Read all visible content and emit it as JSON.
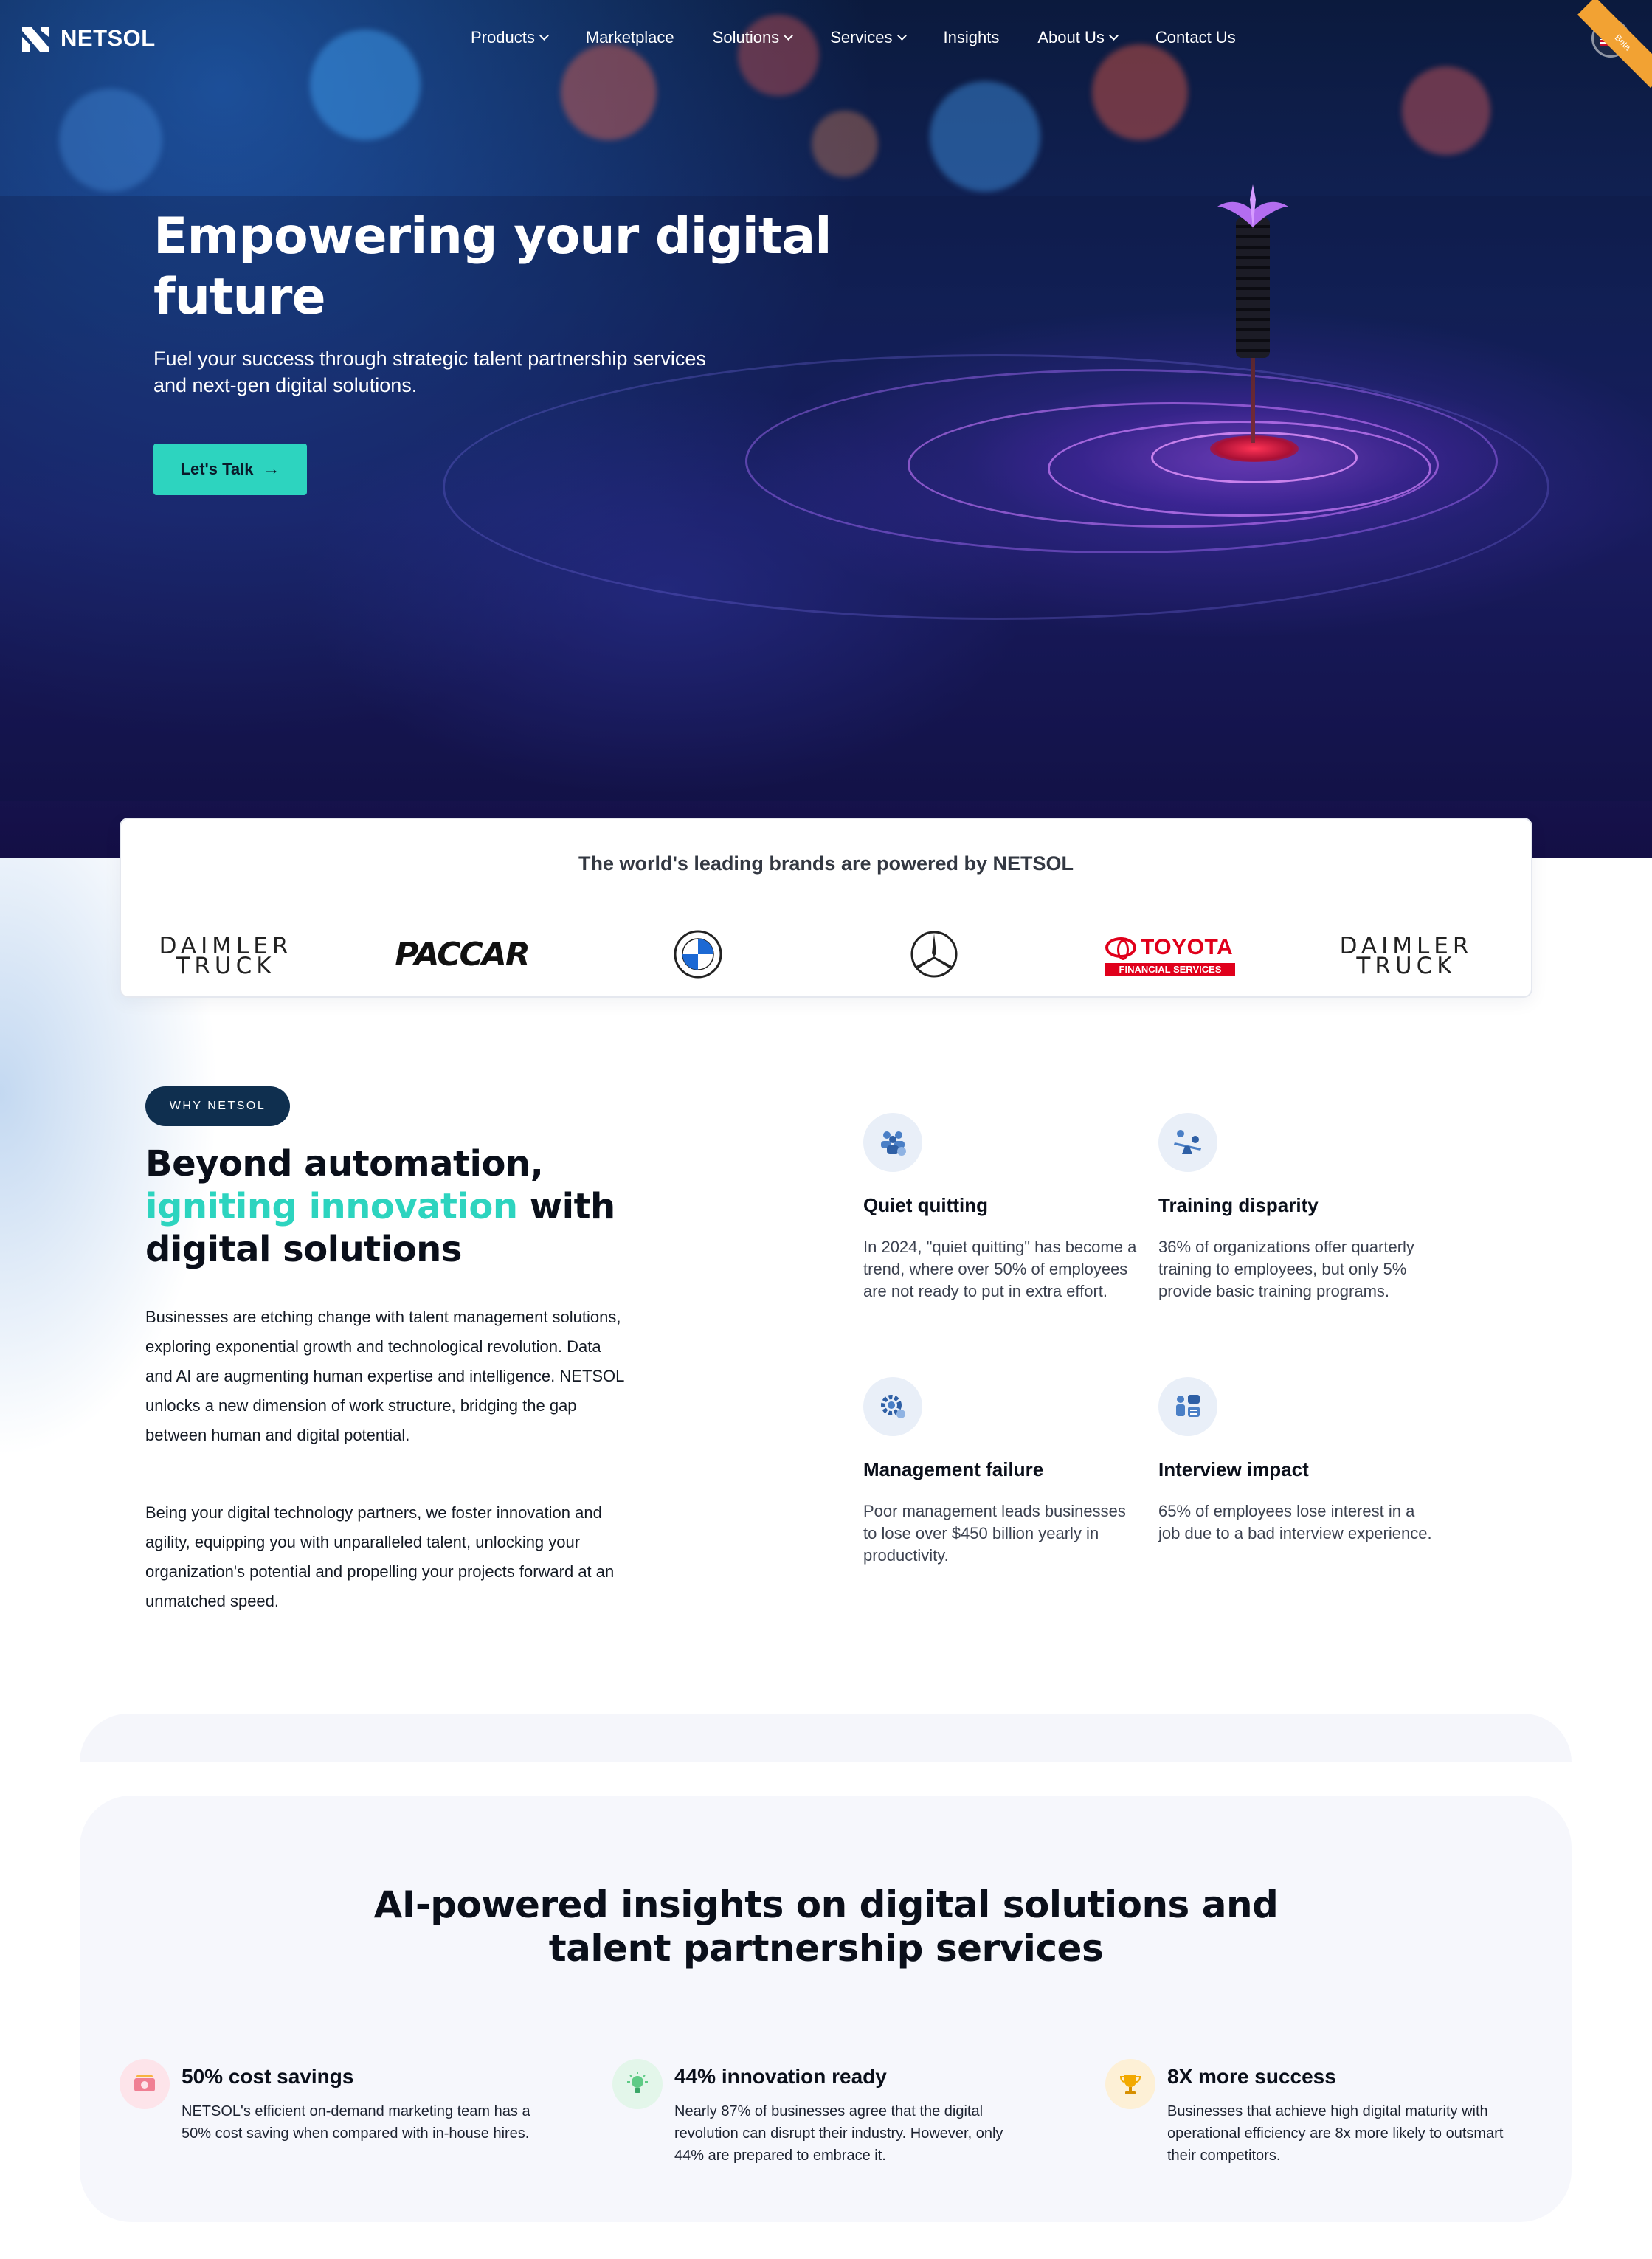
{
  "nav": {
    "logo_text": "NETSOL",
    "items": [
      {
        "label": "Products",
        "dropdown": true
      },
      {
        "label": "Marketplace",
        "dropdown": false
      },
      {
        "label": "Solutions",
        "dropdown": true
      },
      {
        "label": "Services",
        "dropdown": true
      },
      {
        "label": "Insights",
        "dropdown": false
      },
      {
        "label": "About Us",
        "dropdown": true
      },
      {
        "label": "Contact Us",
        "dropdown": false
      }
    ],
    "language_flag": "us-flag-icon",
    "ribbon_text": "Beta"
  },
  "hero": {
    "title": "Empowering your digital future",
    "subtitle": "Fuel your success through strategic talent partnership services and next-gen digital solutions.",
    "cta_label": "Let's Talk"
  },
  "brands": {
    "title": "The world's leading brands are powered by NETSOL",
    "logos": [
      {
        "name": "Daimler Truck",
        "line1": "DAIMLER",
        "line2": "TRUCK"
      },
      {
        "name": "PACCAR",
        "text": "PACCAR"
      },
      {
        "name": "BMW",
        "text": "BMW"
      },
      {
        "name": "Mercedes-Benz",
        "text": ""
      },
      {
        "name": "Toyota Financial Services",
        "text": "TOYOTA",
        "sub": "FINANCIAL SERVICES"
      },
      {
        "name": "Daimler Truck",
        "line1": "DAIMLER",
        "line2": "TRUCK"
      }
    ]
  },
  "why": {
    "badge": "WHY NETSOL",
    "title_part1": "Beyond automation,",
    "title_accent": "igniting innovation",
    "title_part2": "with digital solutions",
    "paragraph1": "Businesses are etching change with talent management solutions, exploring exponential growth and technological revolution. Data and AI are augmenting human expertise and intelligence. NETSOL unlocks a new dimension of work structure, bridging the gap between human and digital potential.",
    "paragraph2": "Being your digital technology partners, we foster innovation and agility, equipping you with unparalleled talent, unlocking your organization's potential and propelling your projects forward at an unmatched speed.",
    "stats": [
      {
        "icon": "team-icon",
        "title": "Quiet quitting",
        "text": "In 2024, \"quiet quitting\" has become a trend, where over 50% of employees are not ready to put in extra effort."
      },
      {
        "icon": "seesaw-icon",
        "title": "Training disparity",
        "text": "36% of organizations offer quarterly training to employees, but only 5% provide basic training programs."
      },
      {
        "icon": "gear-user-icon",
        "title": "Management failure",
        "text": "Poor management leads businesses to lose over $450 billion yearly in productivity."
      },
      {
        "icon": "interview-icon",
        "title": "Interview impact",
        "text": "65% of employees lose interest in a job due to a bad interview experience."
      }
    ]
  },
  "insights": {
    "title_line1": "AI-powered insights on digital solutions and",
    "title_line2": "talent partnership services",
    "cards": [
      {
        "icon": "money-icon",
        "icon_bg": "#fde4ea",
        "title": "50% cost savings",
        "text": "NETSOL's efficient on-demand marketing team has a 50% cost saving when compared with in-house hires."
      },
      {
        "icon": "lightbulb-icon",
        "icon_bg": "#e3f6ea",
        "title": "44% innovation ready",
        "text": "Nearly 87% of businesses agree that the digital revolution can disrupt their industry. However, only 44% are prepared to embrace it."
      },
      {
        "icon": "trophy-icon",
        "icon_bg": "#fdf0d6",
        "title": "8X more success",
        "text": "Businesses that achieve high digital maturity with operational efficiency are 8x more likely to outsmart their competitors."
      }
    ]
  },
  "colors": {
    "accent": "#2dd4bf",
    "badge_bg": "#0f2f4f",
    "toyota_red": "#e0001b"
  }
}
